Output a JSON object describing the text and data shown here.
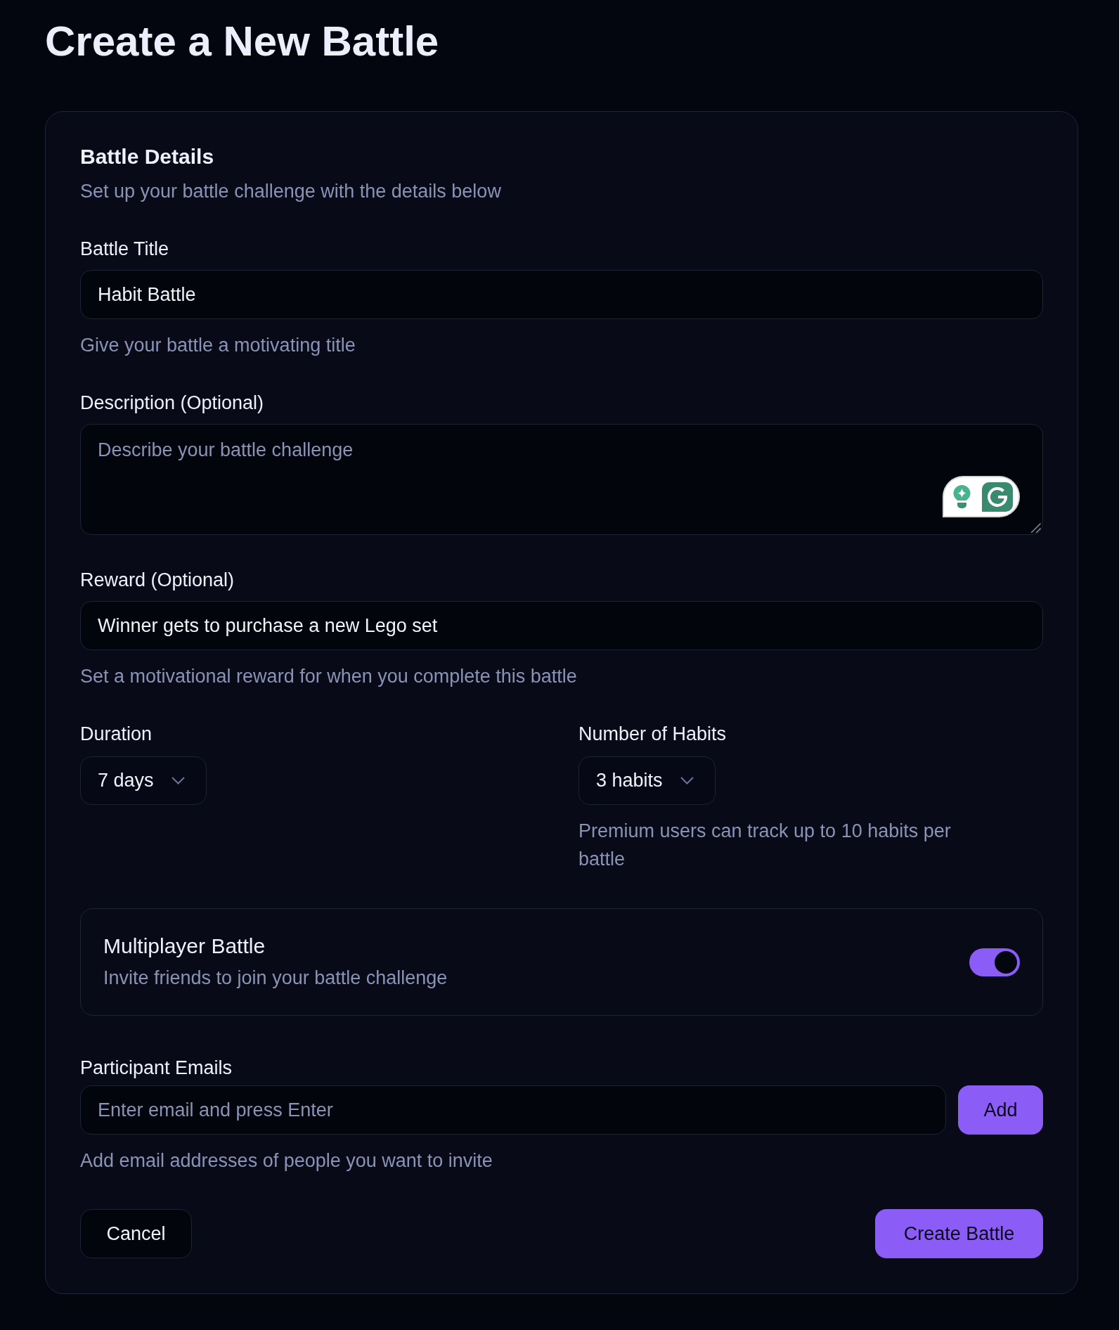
{
  "page": {
    "title": "Create a New Battle"
  },
  "card": {
    "title": "Battle Details",
    "subtitle": "Set up your battle challenge with the details below"
  },
  "fields": [
    {
      "kind": "text",
      "label": "Battle Title",
      "value": "Habit Battle",
      "hint": "Give your battle a motivating title"
    },
    {
      "kind": "textarea",
      "label": "Description (Optional)",
      "placeholder": "Describe your battle challenge"
    },
    {
      "kind": "text",
      "label": "Reward (Optional)",
      "value": "Winner gets to purchase a new Lego set",
      "hint": "Set a motivational reward for when you complete this battle"
    }
  ],
  "selects": [
    {
      "label": "Duration",
      "value": "7 days"
    },
    {
      "label": "Number of Habits",
      "value": "3 habits",
      "hint": "Premium users can track up to 10 habits per battle"
    }
  ],
  "multiplayer": {
    "title": "Multiplayer Battle",
    "subtitle": "Invite friends to join your battle challenge",
    "on": true
  },
  "participants": {
    "label": "Participant Emails",
    "placeholder": "Enter email and press Enter",
    "button": "Add",
    "hint": "Add email addresses of people you want to invite"
  },
  "actions": [
    {
      "kind": "secondary",
      "label": "Cancel"
    },
    {
      "kind": "primary",
      "label": "Create Battle"
    }
  ]
}
